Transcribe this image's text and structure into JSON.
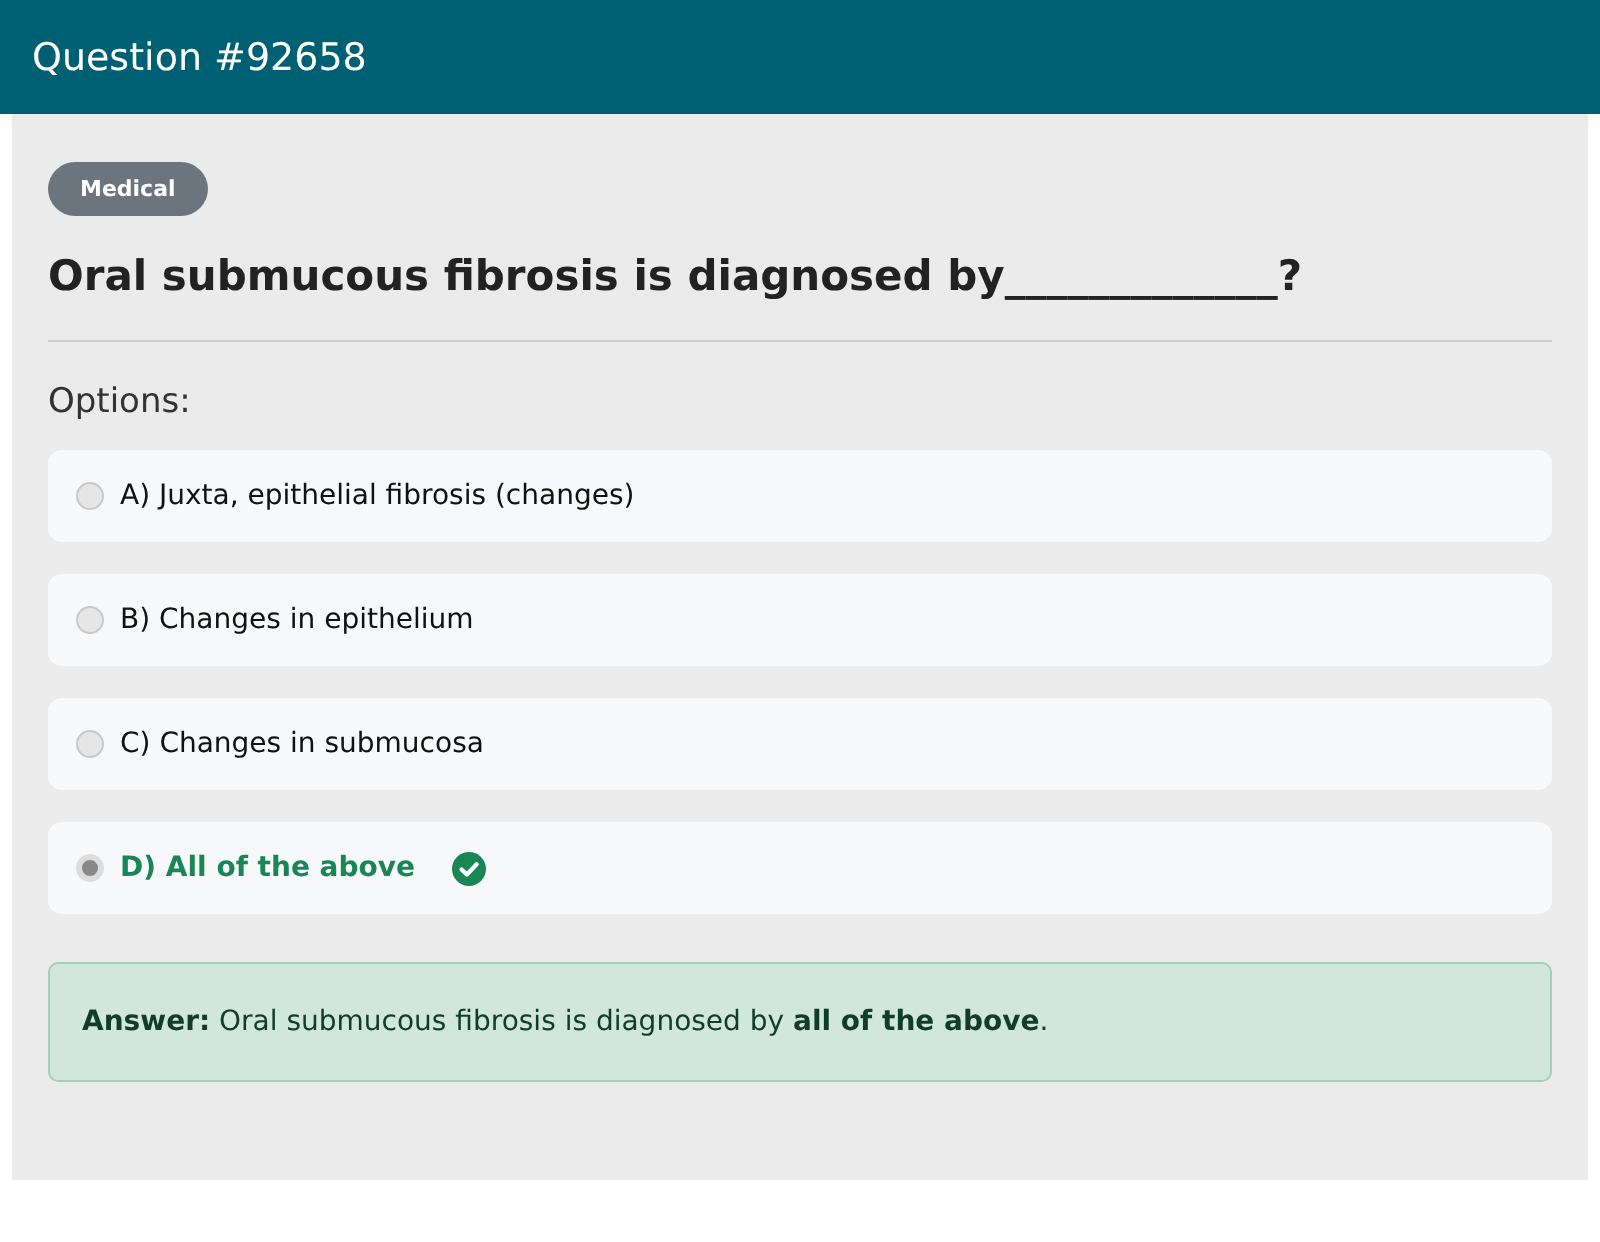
{
  "header": {
    "title": "Question #92658"
  },
  "category": "Medical",
  "question": "Oral submucous fibrosis is diagnosed by_____________?",
  "options_label": "Options:",
  "options": [
    {
      "text": "A) Juxta, epithelial fibrosis (changes)",
      "selected": false,
      "correct": false
    },
    {
      "text": "B) Changes in epithelium",
      "selected": false,
      "correct": false
    },
    {
      "text": "C) Changes in submucosa",
      "selected": false,
      "correct": false
    },
    {
      "text": "D) All of the above",
      "selected": true,
      "correct": true
    }
  ],
  "answer": "**Answer:** Oral submucous fibrosis is diagnosed by **all of the above**."
}
